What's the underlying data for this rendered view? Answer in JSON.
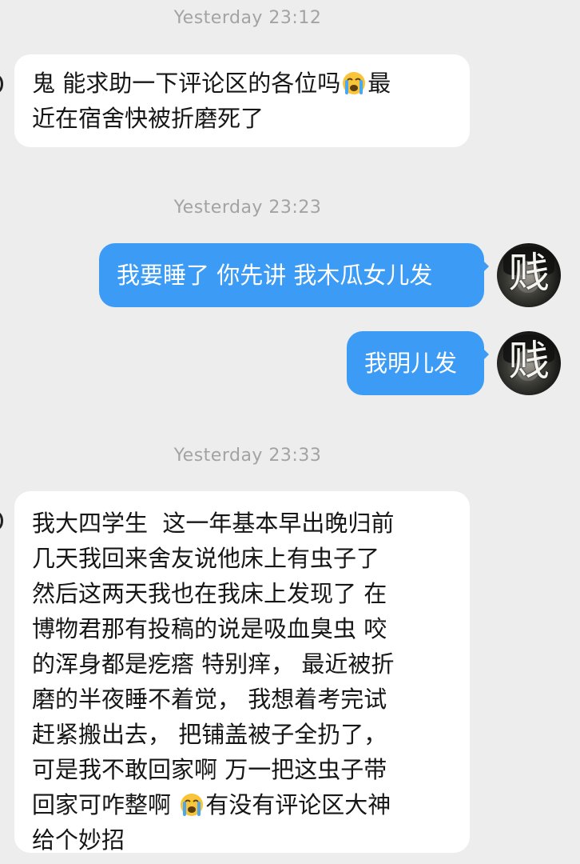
{
  "timestamps": {
    "t1": "Yesterday 23:12",
    "t2": "Yesterday 23:23",
    "t3": "Yesterday 23:33"
  },
  "messages": {
    "m1": {
      "before_emoji": "鬼 能求助一下评论区的各位吗",
      "emoji": "loudly-crying-face",
      "after_emoji": "最\n近在宿舍快被折磨死了"
    },
    "m2": {
      "text": "我要睡了 你先讲 我木瓜女儿发"
    },
    "m3": {
      "text": "我明儿发"
    },
    "m4": {
      "before_emoji": "我大四学生  这一年基本早出晚归前\n几天我回来舍友说他床上有虫子了\n然后这两天我也在我床上发现了 在\n博物君那有投稿的说是吸血臭虫 咬\n的浑身都是疙瘩 特别痒， 最近被折\n磨的半夜睡不着觉， 我想着考完试\n赶紧搬出去， 把铺盖被子全扔了，\n可是我不敢回家啊 万一把这虫子带\n回家可咋整啊 ",
      "emoji": "loudly-crying-face",
      "after_emoji": "有没有评论区大神\n给个妙招"
    }
  },
  "avatar": {
    "char": "贱"
  },
  "colors": {
    "background": "#ededed",
    "bubble_in": "#ffffff",
    "bubble_out": "#3c9cf5",
    "timestamp": "#a3a3a3"
  }
}
